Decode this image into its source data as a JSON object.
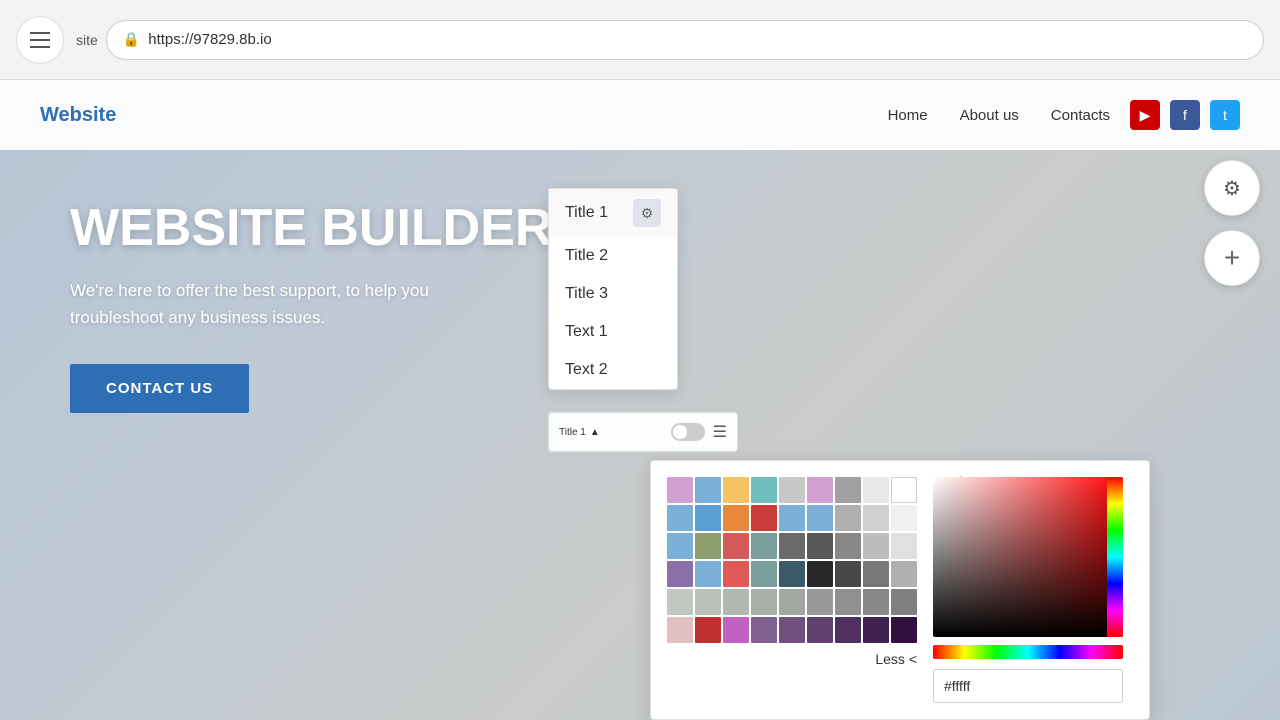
{
  "browser": {
    "menu_label": "menu",
    "site_label": "site",
    "url": "https://97829.8b.io"
  },
  "nav": {
    "logo": "Website",
    "links": [
      {
        "label": "Home",
        "id": "home"
      },
      {
        "label": "About us",
        "id": "about"
      },
      {
        "label": "Contacts",
        "id": "contacts"
      }
    ],
    "social": [
      {
        "id": "youtube",
        "symbol": "▶"
      },
      {
        "id": "facebook",
        "symbol": "f"
      },
      {
        "id": "twitter",
        "symbol": "t"
      }
    ]
  },
  "hero": {
    "title": "WEBSITE BUILDER",
    "subtitle": "We're here to offer the best support, to help you troubleshoot any business issues.",
    "cta_label": "CONTACT US"
  },
  "float_buttons": {
    "settings_icon": "⚙",
    "add_icon": "+"
  },
  "dropdown": {
    "items": [
      {
        "label": "Title 1",
        "has_badge": true
      },
      {
        "label": "Title 2"
      },
      {
        "label": "Title 3"
      },
      {
        "label": "Text 1"
      },
      {
        "label": "Text 2"
      }
    ]
  },
  "toolbar": {
    "label": "Title 1",
    "arrow": "▲"
  },
  "color_picker": {
    "swatches": [
      "#d4a0d4",
      "#7ab0d8",
      "#f5c264",
      "#6fbfbf",
      "#c8c8c8",
      "#d4a0d4",
      "#a0a0a0",
      "#e8e8e8",
      "#ffffff",
      "#7ab0d8",
      "#5a9fd4",
      "#e8883a",
      "#c83c3c",
      "#7ab0d8",
      "#7ab0d8",
      "#b0b0b0",
      "#d0d0d0",
      "#f0f0f0",
      "#7ab0d8",
      "#8a9e70",
      "#d45a5a",
      "#7a9e9e",
      "#6a6a6a",
      "#585858",
      "#888888",
      "#bcbcbc",
      "#e0e0e0",
      "#8a70a8",
      "#7ab0d8",
      "#e05a5a",
      "#7a9e9e",
      "#3a5a6a",
      "#282828",
      "#484848",
      "#787878",
      "#b0b0b0",
      "#c0c0c8",
      "#c0c0c8",
      "#c0c0c8",
      "#c0c0c8",
      "#c0c0c8",
      "#c0c0c8",
      "#c0c0c8",
      "#c0c0c8",
      "#c0c0c8",
      "#e0c0c0",
      "#c03030",
      "#c060c0",
      "#806090",
      "#c0c0c8",
      "#c0c0c8",
      "#c0c0c8",
      "#c0c0c8",
      "#c0c0c8"
    ],
    "less_label": "Less <",
    "hex_value": "#fffff",
    "gradient_arrow": "◂"
  }
}
